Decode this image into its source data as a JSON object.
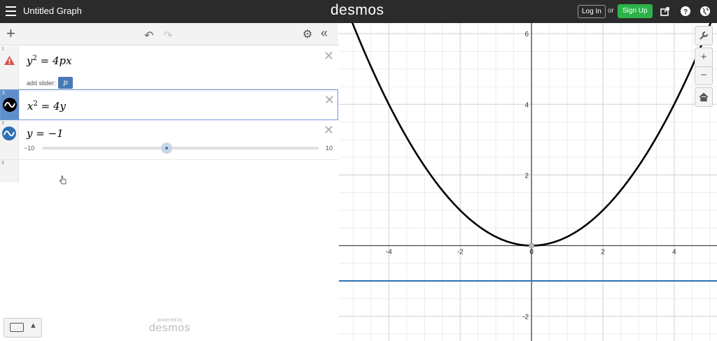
{
  "header": {
    "title": "Untitled Graph",
    "logo": "desmos",
    "login_label": "Log In",
    "or_label": "or",
    "signup_label": "Sign Up",
    "icons": [
      "menu-icon",
      "share-icon",
      "help-icon",
      "globe-icon"
    ],
    "signup_color": "#2bb34a"
  },
  "toolbar": {
    "add_label": "+",
    "undo_icon": "undo-icon",
    "redo_icon": "redo-icon",
    "settings_icon": "gear-icon",
    "collapse_label": "«"
  },
  "expressions": [
    {
      "index": "1",
      "latex_display": "y² = 4px",
      "status_icon": "warning-icon",
      "add_slider_label": "add slider:",
      "slider_var": "p"
    },
    {
      "index": "2",
      "latex_display": "x² = 4y",
      "color": "#000000"
    },
    {
      "index": "3",
      "latex_display": "y = −1",
      "color": "#2d70b3",
      "slider_min": "−10",
      "slider_max": "10",
      "slider_fraction": 0.45
    },
    {
      "index": "4",
      "latex_display": ""
    }
  ],
  "footer": {
    "powered_by": "powered by",
    "brand": "desmos",
    "keyboard_icon": "keyboard-icon"
  },
  "graph_controls": {
    "wrench_icon": "wrench-icon",
    "zoom_in": "+",
    "zoom_out": "−",
    "home_icon": "home-icon"
  },
  "chart_data": {
    "type": "line",
    "xlim": [
      -5.4,
      5.2
    ],
    "ylim": [
      -2.7,
      6.3
    ],
    "x_ticks": [
      -4,
      -2,
      0,
      2,
      4
    ],
    "x_tick_labels": [
      "-4",
      "-2",
      "0",
      "2",
      "4"
    ],
    "y_ticks": [
      -2,
      2,
      4,
      6
    ],
    "y_tick_labels": [
      "-2",
      "2",
      "4",
      "6"
    ],
    "grid": true,
    "series": [
      {
        "equation": "x^2=4y",
        "color": "#000000",
        "x": [
          -5.2,
          -4,
          -2,
          0,
          2,
          4,
          5.2
        ],
        "y": [
          6.76,
          4,
          1,
          0,
          1,
          4,
          6.76
        ]
      },
      {
        "equation": "y=-1",
        "color": "#2d70b3",
        "x": [
          -5.4,
          5.2
        ],
        "y": [
          -1,
          -1
        ]
      }
    ]
  }
}
